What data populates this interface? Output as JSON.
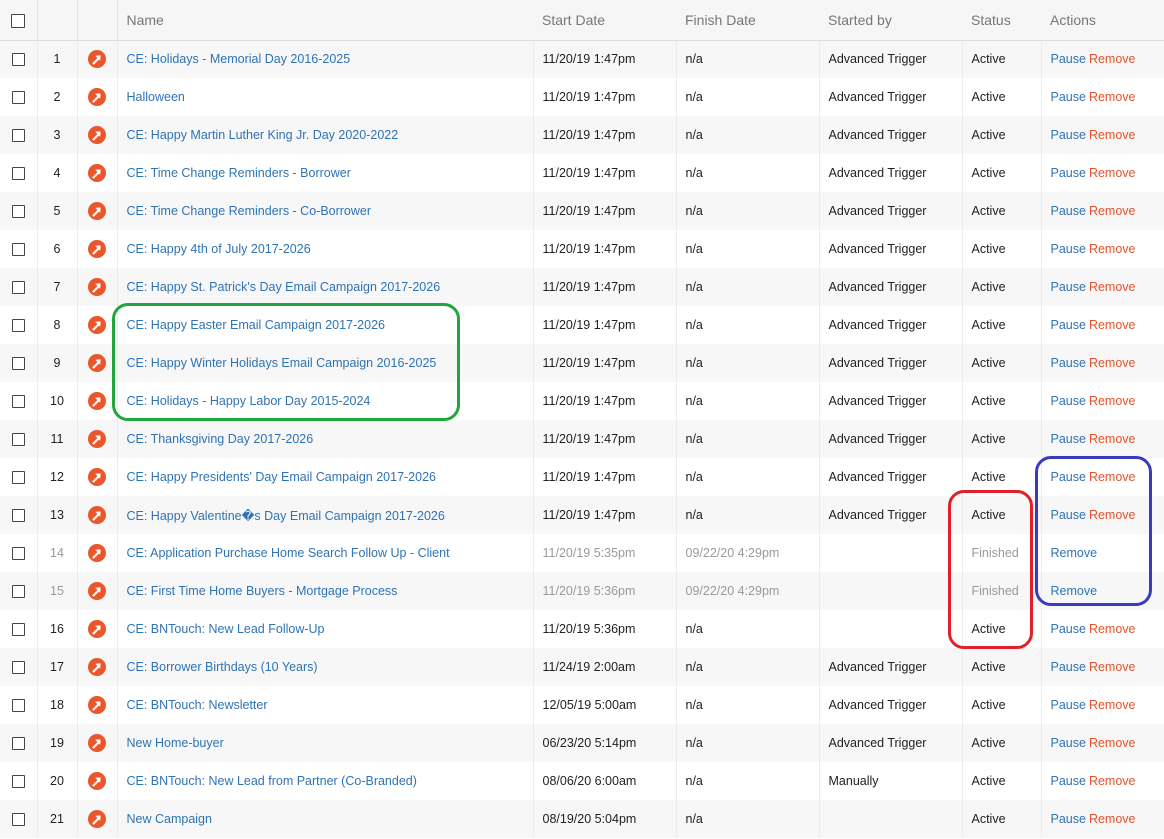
{
  "header": {
    "name": "Name",
    "start_date": "Start Date",
    "finish_date": "Finish Date",
    "started_by": "Started by",
    "status": "Status",
    "actions": "Actions"
  },
  "labels": {
    "pause": "Pause",
    "remove": "Remove"
  },
  "colors": {
    "link": "#2f73b5",
    "remove": "#e4522b",
    "icon": "#e9572b",
    "highlight_green": "#22a53a",
    "highlight_red": "#e0202a",
    "highlight_blue": "#3b3bc0"
  },
  "rows": [
    {
      "num": "1",
      "name": "CE: Holidays - Memorial Day 2016-2025",
      "start": "11/20/19 1:47pm",
      "finish": "n/a",
      "by": "Advanced Trigger",
      "status": "Active",
      "pause": true
    },
    {
      "num": "2",
      "name": "Halloween",
      "start": "11/20/19 1:47pm",
      "finish": "n/a",
      "by": "Advanced Trigger",
      "status": "Active",
      "pause": true
    },
    {
      "num": "3",
      "name": "CE: Happy Martin Luther King Jr. Day 2020-2022",
      "start": "11/20/19 1:47pm",
      "finish": "n/a",
      "by": "Advanced Trigger",
      "status": "Active",
      "pause": true
    },
    {
      "num": "4",
      "name": "CE: Time Change Reminders - Borrower",
      "start": "11/20/19 1:47pm",
      "finish": "n/a",
      "by": "Advanced Trigger",
      "status": "Active",
      "pause": true
    },
    {
      "num": "5",
      "name": "CE: Time Change Reminders - Co-Borrower",
      "start": "11/20/19 1:47pm",
      "finish": "n/a",
      "by": "Advanced Trigger",
      "status": "Active",
      "pause": true
    },
    {
      "num": "6",
      "name": "CE: Happy 4th of July 2017-2026",
      "start": "11/20/19 1:47pm",
      "finish": "n/a",
      "by": "Advanced Trigger",
      "status": "Active",
      "pause": true
    },
    {
      "num": "7",
      "name": "CE: Happy St. Patrick's Day Email Campaign 2017-2026",
      "start": "11/20/19 1:47pm",
      "finish": "n/a",
      "by": "Advanced Trigger",
      "status": "Active",
      "pause": true
    },
    {
      "num": "8",
      "name": "CE: Happy Easter Email Campaign 2017-2026",
      "start": "11/20/19 1:47pm",
      "finish": "n/a",
      "by": "Advanced Trigger",
      "status": "Active",
      "pause": true
    },
    {
      "num": "9",
      "name": "CE: Happy Winter Holidays Email Campaign 2016-2025",
      "start": "11/20/19 1:47pm",
      "finish": "n/a",
      "by": "Advanced Trigger",
      "status": "Active",
      "pause": true
    },
    {
      "num": "10",
      "name": "CE: Holidays - Happy Labor Day 2015-2024",
      "start": "11/20/19 1:47pm",
      "finish": "n/a",
      "by": "Advanced Trigger",
      "status": "Active",
      "pause": true
    },
    {
      "num": "11",
      "name": "CE: Thanksgiving Day 2017-2026",
      "start": "11/20/19 1:47pm",
      "finish": "n/a",
      "by": "Advanced Trigger",
      "status": "Active",
      "pause": true
    },
    {
      "num": "12",
      "name": "CE: Happy Presidents' Day Email Campaign 2017-2026",
      "start": "11/20/19 1:47pm",
      "finish": "n/a",
      "by": "Advanced Trigger",
      "status": "Active",
      "pause": true
    },
    {
      "num": "13",
      "name": "CE: Happy Valentine�s Day Email Campaign 2017-2026",
      "start": "11/20/19 1:47pm",
      "finish": "n/a",
      "by": "Advanced Trigger",
      "status": "Active",
      "pause": true
    },
    {
      "num": "14",
      "name": "CE: Application Purchase Home Search Follow Up - Client",
      "start": "11/20/19 5:35pm",
      "finish": "09/22/20 4:29pm",
      "by": "",
      "status": "Finished",
      "pause": false
    },
    {
      "num": "15",
      "name": "CE: First Time Home Buyers - Mortgage Process",
      "start": "11/20/19 5:36pm",
      "finish": "09/22/20 4:29pm",
      "by": "",
      "status": "Finished",
      "pause": false
    },
    {
      "num": "16",
      "name": "CE: BNTouch: New Lead Follow-Up",
      "start": "11/20/19 5:36pm",
      "finish": "n/a",
      "by": "",
      "status": "Active",
      "pause": true
    },
    {
      "num": "17",
      "name": "CE: Borrower Birthdays (10 Years)",
      "start": "11/24/19 2:00am",
      "finish": "n/a",
      "by": "Advanced Trigger",
      "status": "Active",
      "pause": true
    },
    {
      "num": "18",
      "name": "CE: BNTouch: Newsletter",
      "start": "12/05/19 5:00am",
      "finish": "n/a",
      "by": "Advanced Trigger",
      "status": "Active",
      "pause": true
    },
    {
      "num": "19",
      "name": "New Home-buyer",
      "start": "06/23/20 5:14pm",
      "finish": "n/a",
      "by": "Advanced Trigger",
      "status": "Active",
      "pause": true
    },
    {
      "num": "20",
      "name": "CE: BNTouch: New Lead from Partner (Co-Branded)",
      "start": "08/06/20 6:00am",
      "finish": "n/a",
      "by": "Manually",
      "status": "Active",
      "pause": true
    },
    {
      "num": "21",
      "name": "New Campaign",
      "start": "08/19/20 5:04pm",
      "finish": "n/a",
      "by": "",
      "status": "Active",
      "pause": true
    }
  ]
}
